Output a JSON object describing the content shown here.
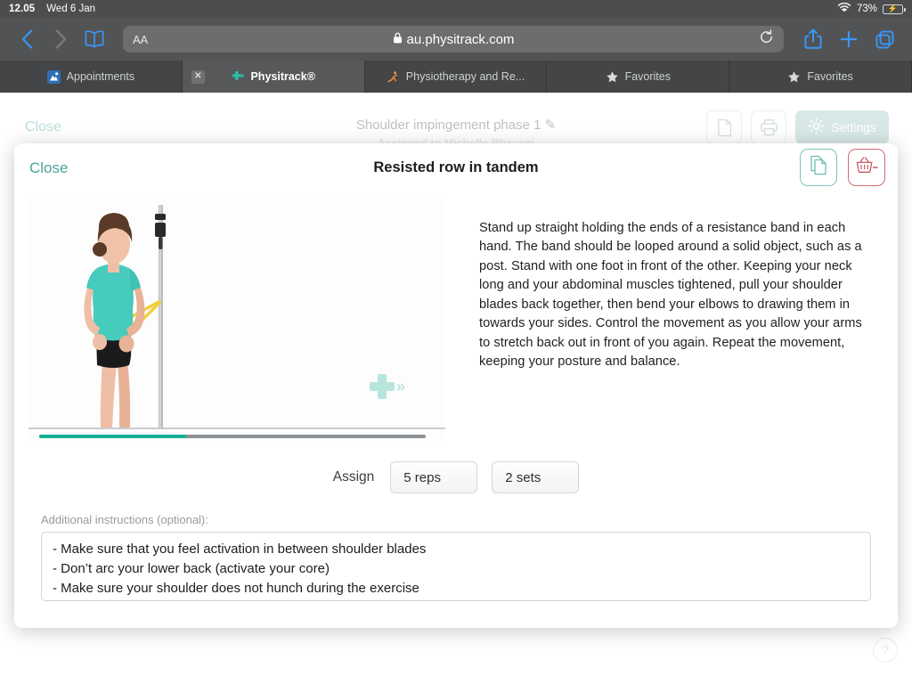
{
  "status_bar": {
    "time": "12.05",
    "date": "Wed 6 Jan",
    "wifi_icon": "wifi-icon",
    "battery_percent": "73%",
    "battery_charging": true
  },
  "browser": {
    "back_icon": "chevron-left-icon",
    "forward_icon": "chevron-right-icon",
    "bookmarks_icon": "book-icon",
    "reader_label": "AA",
    "lock_icon": "lock-icon",
    "url": "au.physitrack.com",
    "reload_icon": "reload-icon",
    "share_icon": "share-icon",
    "new_tab_icon": "plus-icon",
    "tabs_overview_icon": "tabs-icon",
    "tabs": [
      {
        "label": "Appointments",
        "icon": "appointments-favicon",
        "active": false,
        "has_close": false
      },
      {
        "label": "Physitrack®",
        "icon": "physitrack-cross-favicon",
        "active": true,
        "has_close": true,
        "close_icon": "close-icon"
      },
      {
        "label": "Physiotherapy and Re...",
        "icon": "physio-runner-favicon",
        "active": false,
        "has_close": false
      },
      {
        "label": "Favorites",
        "icon": "star-icon",
        "active": false,
        "has_close": false
      },
      {
        "label": "Favorites",
        "icon": "star-icon",
        "active": false,
        "has_close": false
      }
    ]
  },
  "background_page": {
    "close_label": "Close",
    "title": "Shoulder impingement phase 1 ✎",
    "subtitle": "Assigned to Michelle Bhayani",
    "export_icon": "document-icon",
    "print_icon": "printer-icon",
    "settings_icon": "gear-icon",
    "settings_label": "Settings",
    "help_icon": "question-mark-icon"
  },
  "modal": {
    "close_label": "Close",
    "title": "Resisted row in tandem",
    "duplicate_icon": "copy-document-icon",
    "remove_icon": "basket-minus-icon",
    "video": {
      "alt": "Woman performing resisted row in tandem with a yellow resistance band looped around a post",
      "progress_percent": 38,
      "watermark_icon": "physitrack-cross-watermark",
      "accent_color": "#16b096"
    },
    "description": "Stand up straight holding the ends of a resistance band in each hand. The band should be looped around a solid object, such as a post. Stand with one foot in front of the other. Keeping your neck long and your abdominal muscles tightened, pull your shoulder blades back together, then bend your elbows to drawing them in towards your sides. Control the movement as you allow your arms to stretch back out in front of you again. Repeat the movement, keeping your posture and balance.",
    "assign": {
      "label": "Assign",
      "reps": "5 reps",
      "sets": "2 sets"
    },
    "additional_instructions": {
      "label": "Additional instructions (optional):",
      "value": "- Make sure that you feel activation in between shoulder blades\n- Don’t arc your lower back (activate your core)\n- Make sure your shoulder does not hunch during the exercise"
    }
  },
  "colors": {
    "teal_accent": "#4aa59c",
    "progress_teal": "#16b096",
    "danger_red": "#c75a64",
    "chrome_gray": "#515354"
  }
}
